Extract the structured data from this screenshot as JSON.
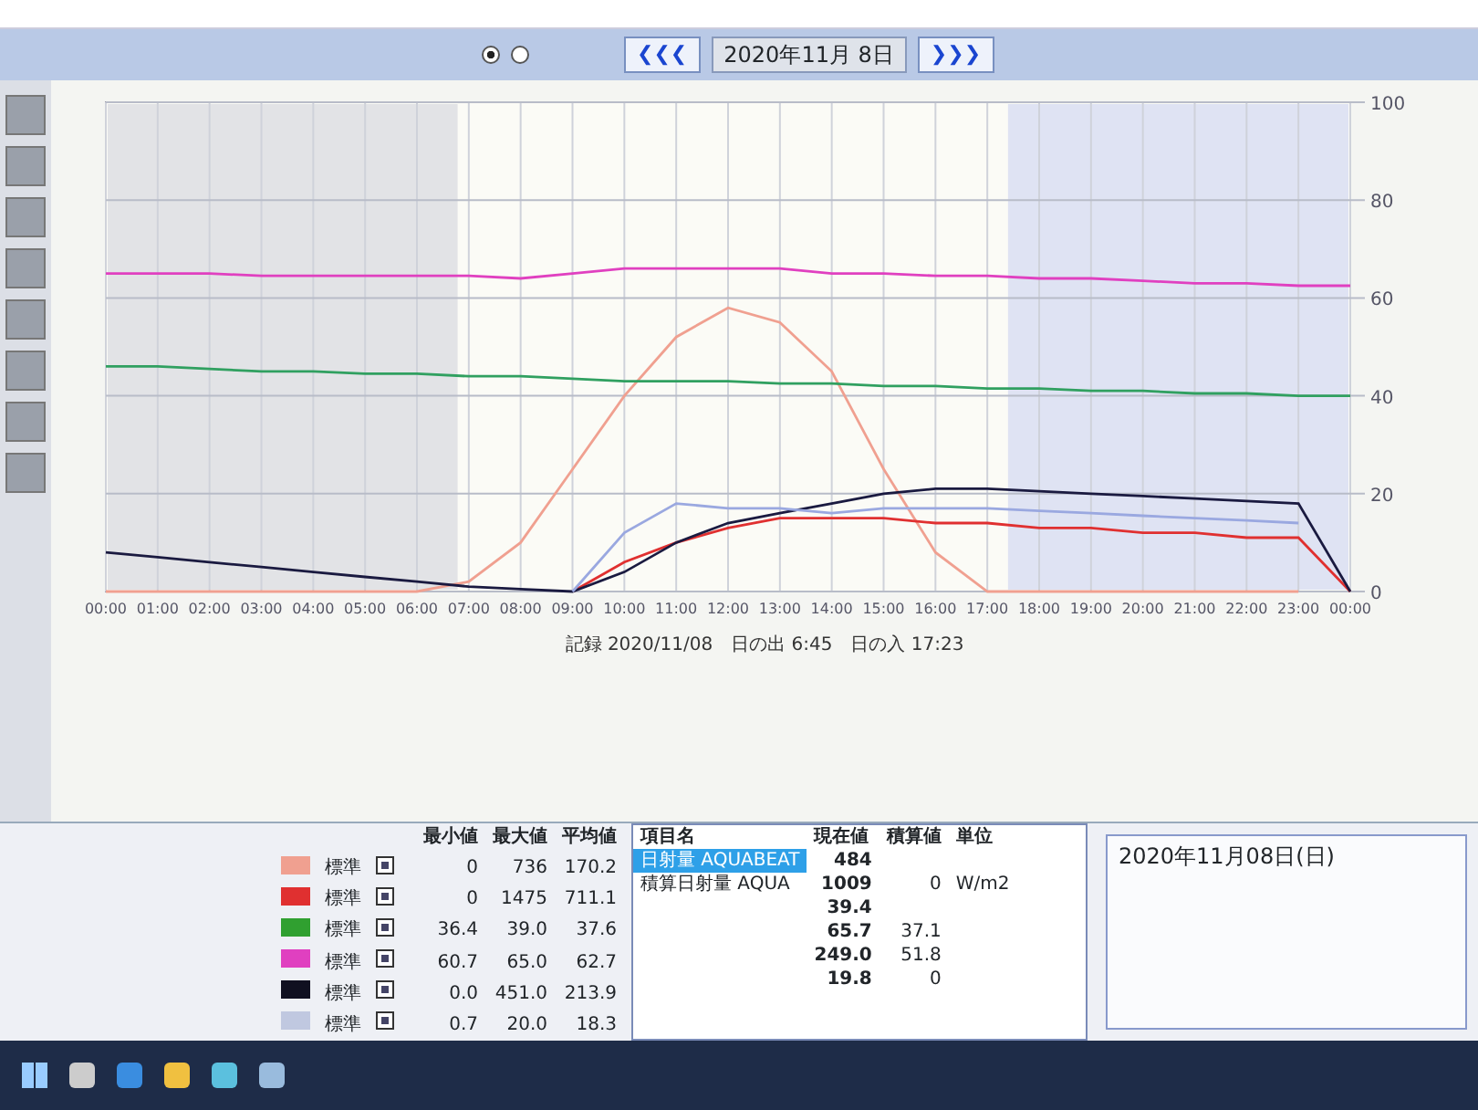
{
  "toolbar": {
    "prev_label": "❮❮❮",
    "date": "2020年11月 8日",
    "next_label": "❯❯❯",
    "view_options": [
      {
        "selected": true
      },
      {
        "selected": false
      }
    ]
  },
  "chart": {
    "caption": "記録 2020/11/08　日の出 6:45　日の入 17:23",
    "chart_data": {
      "type": "line",
      "categories": [
        "00:00",
        "01:00",
        "02:00",
        "03:00",
        "04:00",
        "05:00",
        "06:00",
        "07:00",
        "08:00",
        "09:00",
        "10:00",
        "11:00",
        "12:00",
        "13:00",
        "14:00",
        "15:00",
        "16:00",
        "17:00",
        "18:00",
        "19:00",
        "20:00",
        "21:00",
        "22:00",
        "23:00",
        "00:00"
      ],
      "ylim": [
        0,
        100
      ],
      "grid": true,
      "yticks": [
        0,
        20,
        40,
        60,
        80,
        100
      ],
      "series": [
        {
          "color": "#f0a090",
          "values": [
            0,
            0,
            0,
            0,
            0,
            0,
            0,
            2,
            10,
            25,
            40,
            52,
            58,
            55,
            45,
            25,
            8,
            0,
            0,
            0,
            0,
            0,
            0,
            0,
            null
          ]
        },
        {
          "color": "#e03030",
          "values": [
            null,
            null,
            null,
            null,
            null,
            null,
            null,
            null,
            null,
            0,
            6,
            10,
            13,
            15,
            15,
            15,
            14,
            14,
            13,
            13,
            12,
            12,
            11,
            11,
            0
          ]
        },
        {
          "color": "#30a060",
          "values": [
            46,
            46,
            45.5,
            45,
            45,
            44.5,
            44.5,
            44,
            44,
            43.5,
            43,
            43,
            43,
            42.5,
            42.5,
            42,
            42,
            41.5,
            41.5,
            41,
            41,
            40.5,
            40.5,
            40,
            40
          ]
        },
        {
          "color": "#e040c0",
          "values": [
            65,
            65,
            65,
            64.5,
            64.5,
            64.5,
            64.5,
            64.5,
            64,
            65,
            66,
            66,
            66,
            66,
            65,
            65,
            64.5,
            64.5,
            64,
            64,
            63.5,
            63,
            63,
            62.5,
            62.5
          ]
        },
        {
          "color": "#1a1a40",
          "values": [
            8,
            7,
            6,
            5,
            4,
            3,
            2,
            1,
            0.5,
            0,
            4,
            10,
            14,
            16,
            18,
            20,
            21,
            21,
            20.5,
            20,
            19.5,
            19,
            18.5,
            18,
            0
          ]
        },
        {
          "color": "#9aa8e0",
          "values": [
            null,
            null,
            null,
            null,
            null,
            null,
            null,
            null,
            null,
            0,
            12,
            18,
            17,
            17,
            16,
            17,
            17,
            17,
            16.5,
            16,
            15.5,
            15,
            14.5,
            14,
            null
          ]
        }
      ]
    }
  },
  "legend": {
    "columns": [
      "最小値",
      "最大値",
      "平均値"
    ],
    "rows": [
      {
        "color": "#f0a090",
        "line": "標準",
        "shown": true,
        "min": "0",
        "max": "736",
        "avg": "170.2"
      },
      {
        "color": "#e03030",
        "line": "標準",
        "shown": true,
        "min": "0",
        "max": "1475",
        "avg": "711.1"
      },
      {
        "color": "#30a030",
        "line": "標準",
        "shown": true,
        "min": "36.4",
        "max": "39.0",
        "avg": "37.6"
      },
      {
        "color": "#e040c0",
        "line": "標準",
        "shown": true,
        "min": "60.7",
        "max": "65.0",
        "avg": "62.7"
      },
      {
        "color": "#101020",
        "line": "標準",
        "shown": true,
        "min": "0.0",
        "max": "451.0",
        "avg": "213.9"
      },
      {
        "color": "#c0c8e0",
        "line": "標準",
        "shown": true,
        "min": "0.7",
        "max": "20.0",
        "avg": "18.3"
      }
    ]
  },
  "current": {
    "columns": [
      "項目名",
      "現在値",
      "積算値",
      "単位"
    ],
    "rows": [
      {
        "name": "日射量 AQUABEAT",
        "value": "484",
        "selected": true
      },
      {
        "name": "積算日射量 AQUA",
        "value": "1009",
        "sum": "0",
        "unit": "W/m2",
        "selected": false
      },
      {
        "value": "39.4",
        "selected": false
      },
      {
        "value": "65.7",
        "sum": "37.1",
        "selected": false
      },
      {
        "value": "249.0",
        "sum": "51.8",
        "selected": false
      },
      {
        "value": "19.8",
        "sum": "0",
        "selected": false
      }
    ]
  },
  "date_panel": {
    "title": "2020年11月08日(日)"
  }
}
